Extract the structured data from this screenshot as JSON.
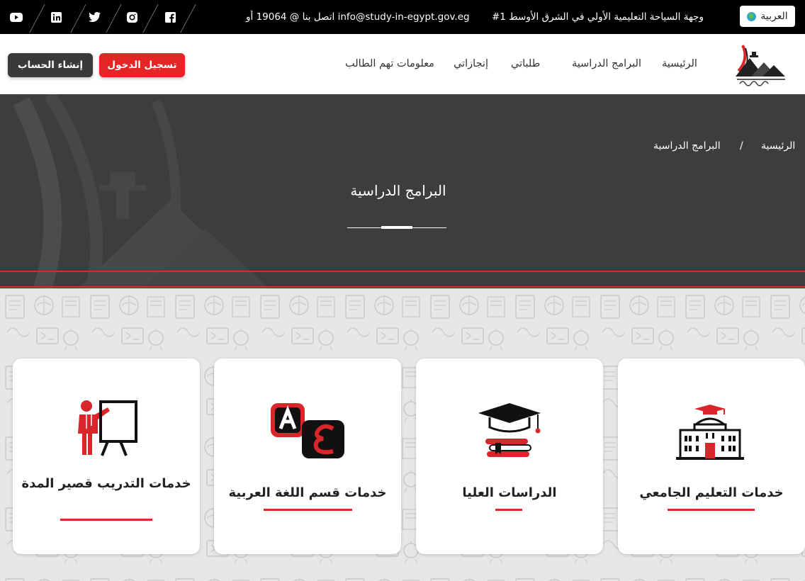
{
  "topbar": {
    "language": "العربية",
    "slogan": "#1 وجهة السياحة التعليمية الأولي في الشرق الأوسط",
    "contact": "اتصل بنا @ 19064 أو info@study-in-egypt.gov.eg",
    "social": [
      {
        "icon": "youtube-icon",
        "glyph": "▶"
      },
      {
        "icon": "linkedin-icon",
        "glyph": "in"
      },
      {
        "icon": "twitter-icon",
        "glyph": "🐦"
      },
      {
        "icon": "instagram-icon",
        "glyph": "◎"
      },
      {
        "icon": "facebook-icon",
        "glyph": "f"
      }
    ]
  },
  "nav": {
    "items": [
      "الرئيسية",
      "البرامج الدراسية",
      "طلباتي",
      "إنجازاتي",
      "معلومات تهم الطالب"
    ],
    "login": "تسجيل الدخول",
    "register": "إنشاء الحساب"
  },
  "hero": {
    "breadcrumb_home": "الرئيسية",
    "breadcrumb_sep": "/",
    "breadcrumb_current": "البرامج الدراسية",
    "title": "البرامج الدراسية"
  },
  "cards": [
    {
      "title": "خدمات التعليم الجامعي",
      "icon": "university-building-icon"
    },
    {
      "title": "الدراسات العليا",
      "icon": "graduation-cap-books-icon"
    },
    {
      "title": "خدمات قسم اللغة العربية",
      "icon": "arabic-letters-icon"
    },
    {
      "title": "خدمات التدريب قصير المدة",
      "icon": "trainer-board-icon"
    }
  ],
  "colors": {
    "accent": "#e32526",
    "dark": "#3d3d3d",
    "topbar": "#000000"
  }
}
